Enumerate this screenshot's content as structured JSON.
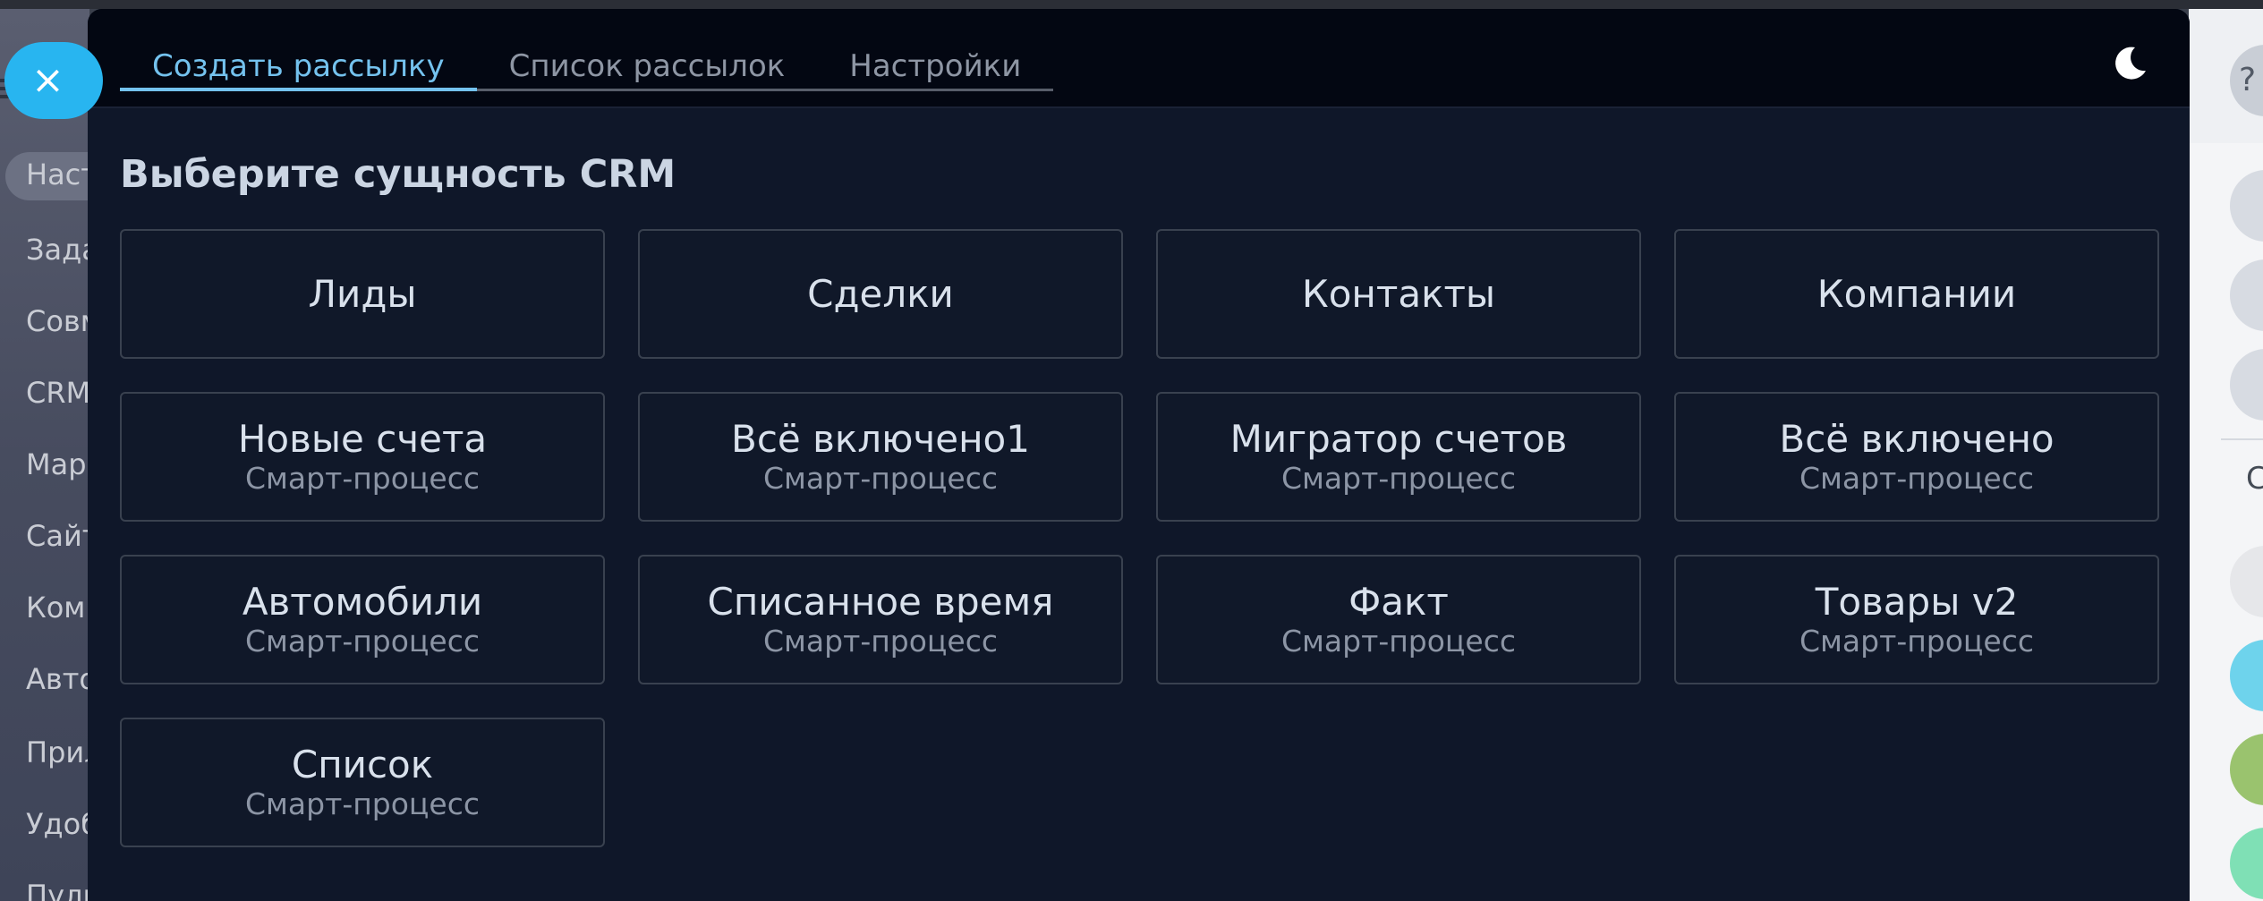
{
  "background": {
    "left_items": [
      "Наст",
      "Зада",
      "Совм",
      "CRM",
      "Мар",
      "Сайт",
      "Комп",
      "Авто",
      "Прил",
      "Удоб",
      "Пулы"
    ],
    "right_letter": "С",
    "right_icon_letter": "?"
  },
  "close_button": {
    "icon": "close-icon",
    "glyph": "×"
  },
  "header": {
    "tabs": [
      {
        "label": "Создать рассылку",
        "active": true
      },
      {
        "label": "Список рассылок",
        "active": false
      },
      {
        "label": "Настройки",
        "active": false
      }
    ],
    "theme_toggle_icon": "moon-icon"
  },
  "main": {
    "title": "Выберите сущность CRM",
    "entities": [
      {
        "title": "Лиды",
        "subtitle": ""
      },
      {
        "title": "Сделки",
        "subtitle": ""
      },
      {
        "title": "Контакты",
        "subtitle": ""
      },
      {
        "title": "Компании",
        "subtitle": ""
      },
      {
        "title": "Новые счета",
        "subtitle": "Смарт-процесс"
      },
      {
        "title": "Всё включено1",
        "subtitle": "Смарт-процесс"
      },
      {
        "title": "Мигратор счетов",
        "subtitle": "Смарт-процесс"
      },
      {
        "title": "Всё включено",
        "subtitle": "Смарт-процесс"
      },
      {
        "title": "Автомобили",
        "subtitle": "Смарт-процесс"
      },
      {
        "title": "Списанное время",
        "subtitle": "Смарт-процесс"
      },
      {
        "title": "Факт",
        "subtitle": "Смарт-процесс"
      },
      {
        "title": "Товары v2",
        "subtitle": "Смарт-процесс"
      },
      {
        "title": "Список",
        "subtitle": "Смарт-процесс"
      }
    ]
  },
  "colors": {
    "panel_bg": "#0f1729",
    "header_bg": "#030712",
    "accent": "#74c2ee",
    "close_button": "#28b5f0"
  }
}
